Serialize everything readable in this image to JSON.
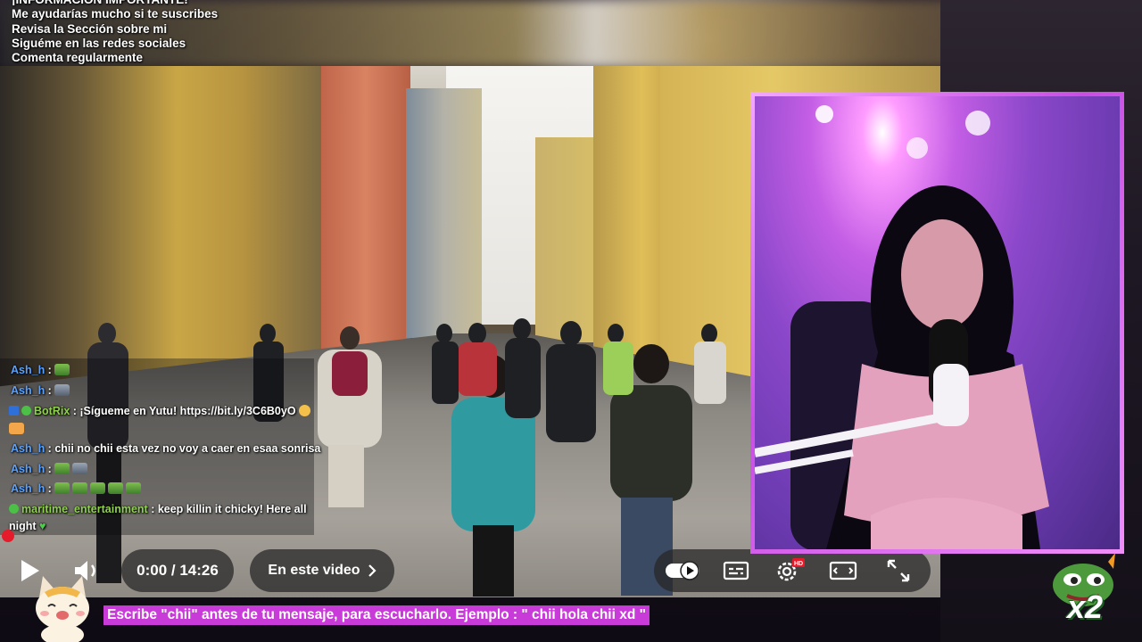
{
  "info": {
    "heading": "¡INFORMACIÓN IMPORTANTE!",
    "lines": [
      "Me ayudarías mucho si te suscribes",
      "Revisa la Sección sobre mi",
      "Siguéme en las redes sociales",
      "Comenta regularmente"
    ]
  },
  "chat": {
    "messages": [
      {
        "user": "Ash_h",
        "text": "",
        "emotes": [
          "frog"
        ]
      },
      {
        "user": "Ash_h",
        "text": "",
        "emotes": [
          "gray"
        ]
      },
      {
        "user": "BotRix",
        "text": "¡Sígueme en Yutu! https://bit.ly/3C6B0yO",
        "emotes": []
      },
      {
        "user": "Ash_h",
        "text": "chii no chii esta vez no voy a caer en esaa sonrisa",
        "emotes": []
      },
      {
        "user": "Ash_h",
        "text": "",
        "emotes": [
          "frog",
          "gray"
        ]
      },
      {
        "user": "Ash_h",
        "text": "",
        "emotes": [
          "frog",
          "frog",
          "frog",
          "frog",
          "frog"
        ]
      },
      {
        "user": "maritime_entertainment",
        "text": "keep killin it chicky! Here all",
        "continuation": "night",
        "emotes": []
      }
    ]
  },
  "player": {
    "time": "0:00 / 14:26",
    "chapters_label": "En este video",
    "progress_fraction": 0.0,
    "hd_badge": "HD",
    "autoplay_on": true
  },
  "banner": {
    "text": "Escribe \"chii\" antes de tu mensaje, para escucharlo. Ejemplo : \" chii hola chii xd \""
  },
  "multiplier": "x2",
  "colors": {
    "accent": "#c93bd8",
    "progress": "#e51b2b",
    "chat_user": "#5aa2ff",
    "chat_user_mod": "#8fd14f"
  },
  "icons": [
    "play-icon",
    "volume-icon",
    "chevron-right-icon",
    "autoplay-toggle-icon",
    "subtitles-icon",
    "settings-icon",
    "theater-mode-icon",
    "fullscreen-icon"
  ]
}
